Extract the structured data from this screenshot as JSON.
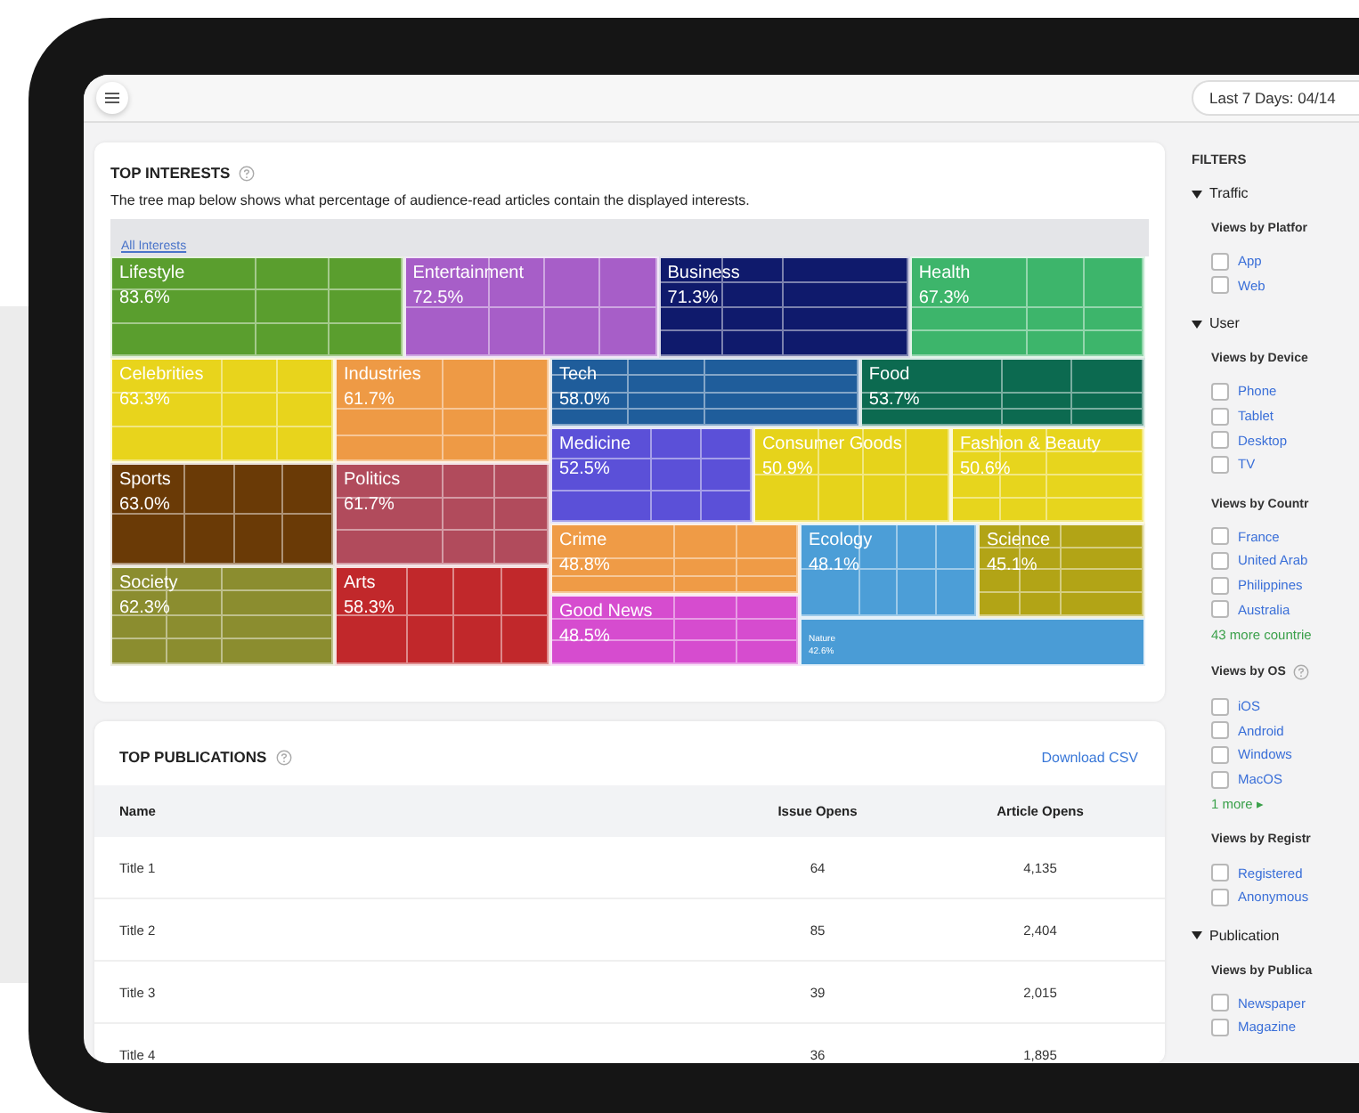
{
  "header": {
    "date_range": "Last 7 Days: 04/14"
  },
  "top_interests": {
    "title": "TOP INTERESTS",
    "description": "The tree map below shows what percentage of audience-read articles contain the displayed interests.",
    "breadcrumb": "All Interests",
    "tiles": [
      {
        "label": "Lifestyle",
        "value": "83.6%",
        "color": "#5a9e2e"
      },
      {
        "label": "Entertainment",
        "value": "72.5%",
        "color": "#a75ec8"
      },
      {
        "label": "Business",
        "value": "71.3%",
        "color": "#0f1a6c"
      },
      {
        "label": "Health",
        "value": "67.3%",
        "color": "#3db56b"
      },
      {
        "label": "Celebrities",
        "value": "63.3%",
        "color": "#e8d41c"
      },
      {
        "label": "Sports",
        "value": "63.0%",
        "color": "#6a3a06"
      },
      {
        "label": "Society",
        "value": "62.3%",
        "color": "#8b8d2f"
      },
      {
        "label": "Industries",
        "value": "61.7%",
        "color": "#ee9a45"
      },
      {
        "label": "Politics",
        "value": "61.7%",
        "color": "#b14b5c"
      },
      {
        "label": "Arts",
        "value": "58.3%",
        "color": "#c1282b"
      },
      {
        "label": "Tech",
        "value": "58.0%",
        "color": "#1f5d9b"
      },
      {
        "label": "Food",
        "value": "53.7%",
        "color": "#0c6a50"
      },
      {
        "label": "Medicine",
        "value": "52.5%",
        "color": "#5b50d8"
      },
      {
        "label": "Consumer Goods",
        "value": "50.9%",
        "color": "#e6d31b"
      },
      {
        "label": "Fashion & Beauty",
        "value": "50.6%",
        "color": "#e7d51d"
      },
      {
        "label": "Crime",
        "value": "48.8%",
        "color": "#ef9b46"
      },
      {
        "label": "Good News",
        "value": "48.5%",
        "color": "#d64ccf"
      },
      {
        "label": "Ecology",
        "value": "48.1%",
        "color": "#4c9ed7"
      },
      {
        "label": "Science",
        "value": "45.1%",
        "color": "#b2a416"
      },
      {
        "label": "Nature",
        "value": "42.6%",
        "color": "#4a9cd6"
      }
    ]
  },
  "top_publications": {
    "title": "TOP PUBLICATIONS",
    "download": "Download CSV",
    "columns": [
      "Name",
      "Issue Opens",
      "Article Opens"
    ],
    "rows": [
      [
        "Title 1",
        "64",
        "4,135"
      ],
      [
        "Title 2",
        "85",
        "2,404"
      ],
      [
        "Title 3",
        "39",
        "2,015"
      ],
      [
        "Title 4",
        "36",
        "1,895"
      ]
    ]
  },
  "filters": {
    "title": "FILTERS",
    "sections": [
      {
        "label": "Traffic",
        "expanded": true,
        "groups": [
          {
            "title": "Views by Platfor",
            "options": [
              {
                "label": "App",
                "checked": false
              },
              {
                "label": "Web",
                "checked": false
              }
            ]
          }
        ]
      },
      {
        "label": "User",
        "expanded": true,
        "groups": [
          {
            "title": "Views by Device",
            "options": [
              {
                "label": "Phone",
                "checked": false
              },
              {
                "label": "Tablet",
                "checked": false
              },
              {
                "label": "Desktop",
                "checked": false
              },
              {
                "label": "TV",
                "checked": false
              }
            ]
          },
          {
            "title": "Views by Countr",
            "options": [
              {
                "label": "France",
                "checked": false
              },
              {
                "label": "United Arab",
                "checked": false
              },
              {
                "label": "Philippines",
                "checked": false
              },
              {
                "label": "Australia",
                "checked": false
              }
            ],
            "more": "43 more countrie"
          },
          {
            "title": "Views by OS",
            "help": true,
            "options": [
              {
                "label": "iOS",
                "checked": false
              },
              {
                "label": "Android",
                "checked": false
              },
              {
                "label": "Windows",
                "checked": false
              },
              {
                "label": "MacOS",
                "checked": false
              }
            ],
            "more": "1 more ▸"
          },
          {
            "title": "Views by Registr",
            "options": [
              {
                "label": "Registered",
                "checked": false
              },
              {
                "label": "Anonymous",
                "checked": false
              }
            ]
          }
        ]
      },
      {
        "label": "Publication",
        "expanded": true,
        "groups": [
          {
            "title": "Views by Publica",
            "options": [
              {
                "label": "Newspaper",
                "checked": false
              },
              {
                "label": "Magazine",
                "checked": false
              }
            ]
          }
        ]
      }
    ]
  }
}
